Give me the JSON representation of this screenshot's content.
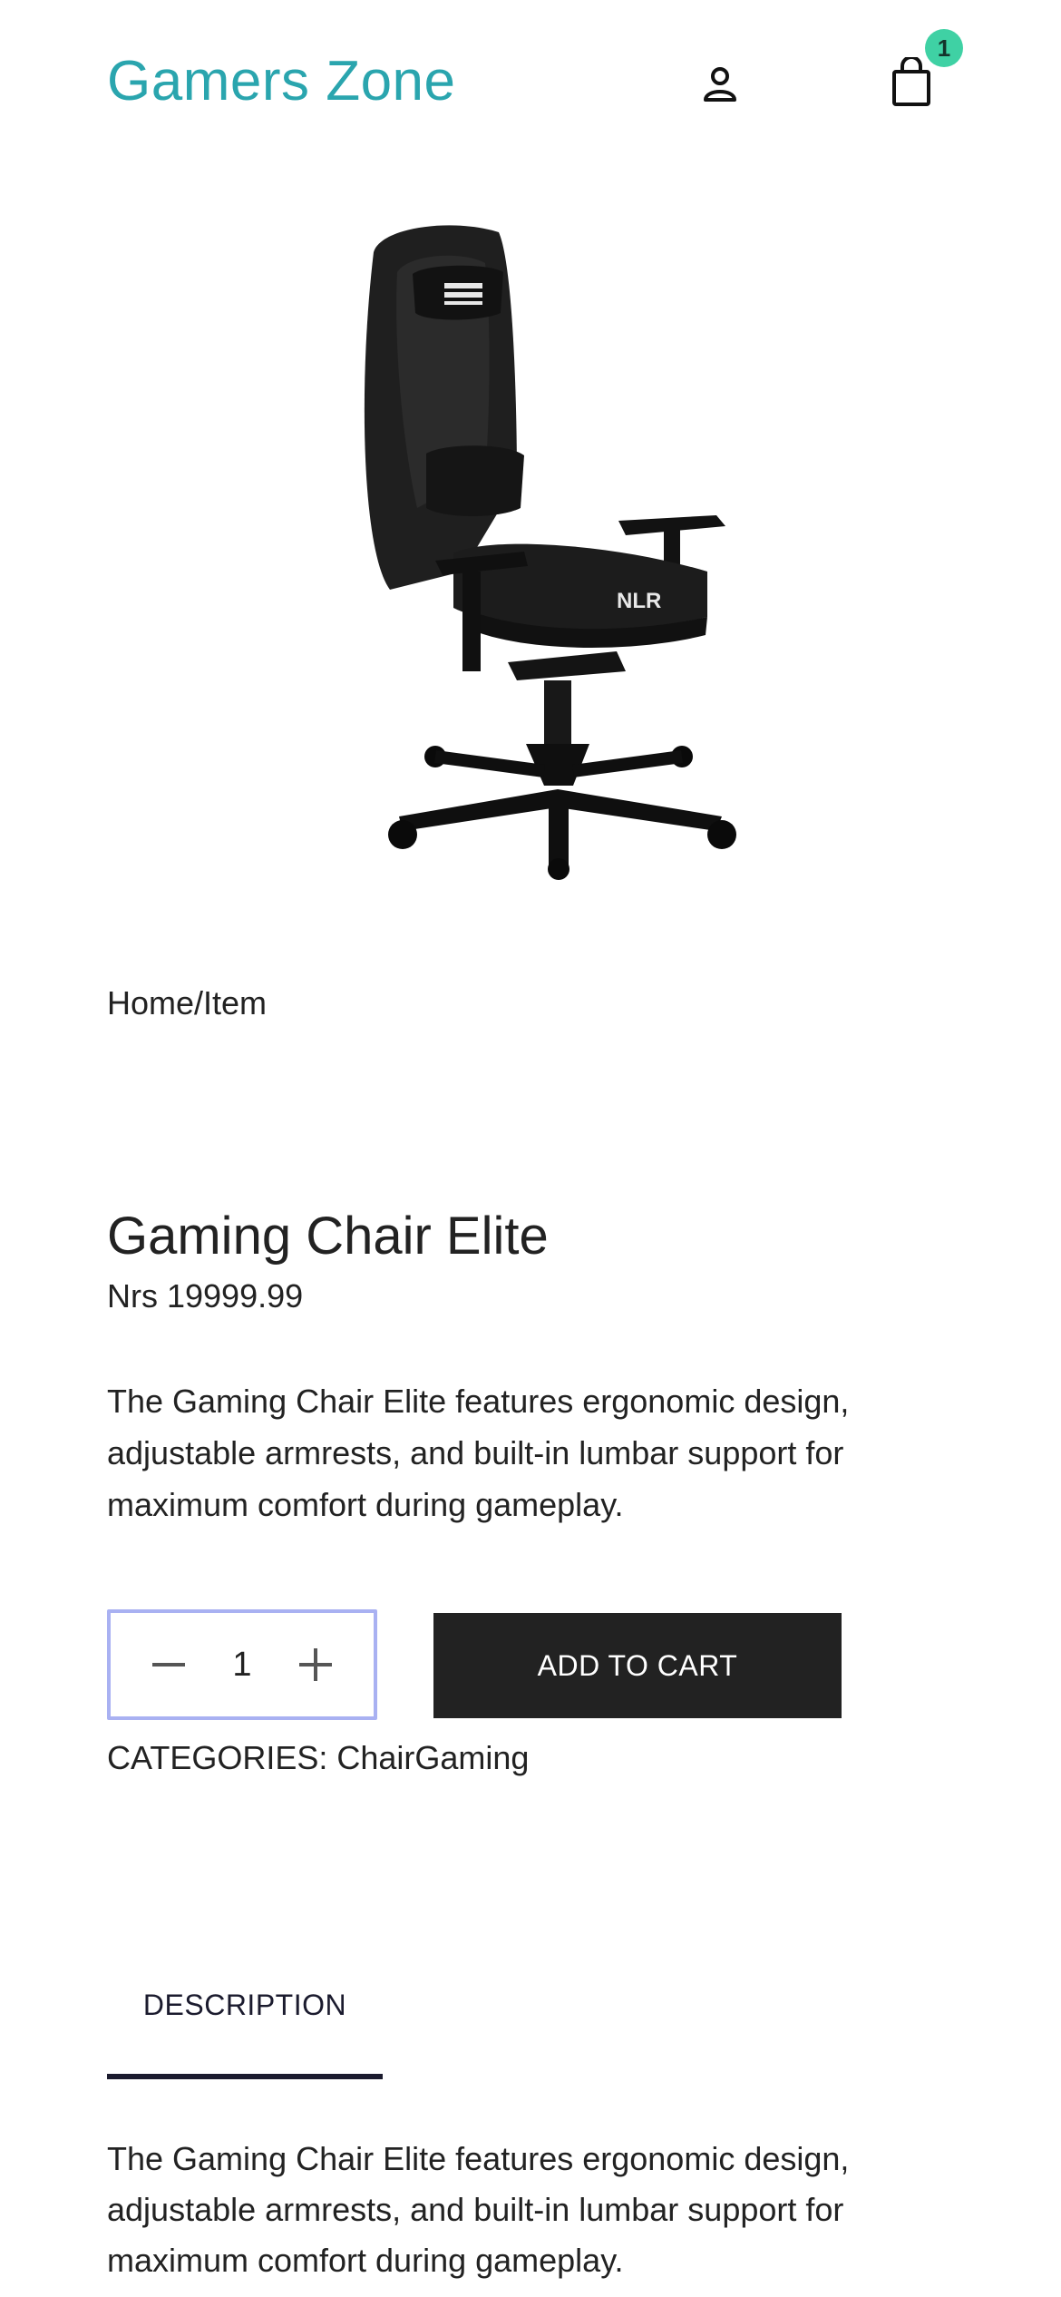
{
  "colors": {
    "brand": "#2aa5ae",
    "badge": "#3fd1a4",
    "button_bg": "#222222",
    "qty_border": "#a9b1f2",
    "tab_underline": "#1b1b2e"
  },
  "header": {
    "brand": "Gamers Zone",
    "user_icon": "user-icon",
    "cart_icon": "shopping-bag-icon",
    "cart_count": "1"
  },
  "breadcrumb": "Home/Item",
  "product": {
    "image": "gaming-chair-image",
    "title": "Gaming Chair Elite",
    "price": "Nrs 19999.99",
    "description": "The Gaming Chair Elite features ergonomic design, adjustable armrests, and built-in lumbar support for maximum comfort during gameplay.",
    "quantity": "1",
    "add_to_cart_label": "ADD TO CART",
    "categories": "CATEGORIES: ChairGaming"
  },
  "tabs": [
    {
      "label": "DESCRIPTION",
      "active": true
    }
  ],
  "tab_content": "The Gaming Chair Elite features ergonomic design, adjustable armrests, and built-in lumbar support for maximum comfort during gameplay."
}
